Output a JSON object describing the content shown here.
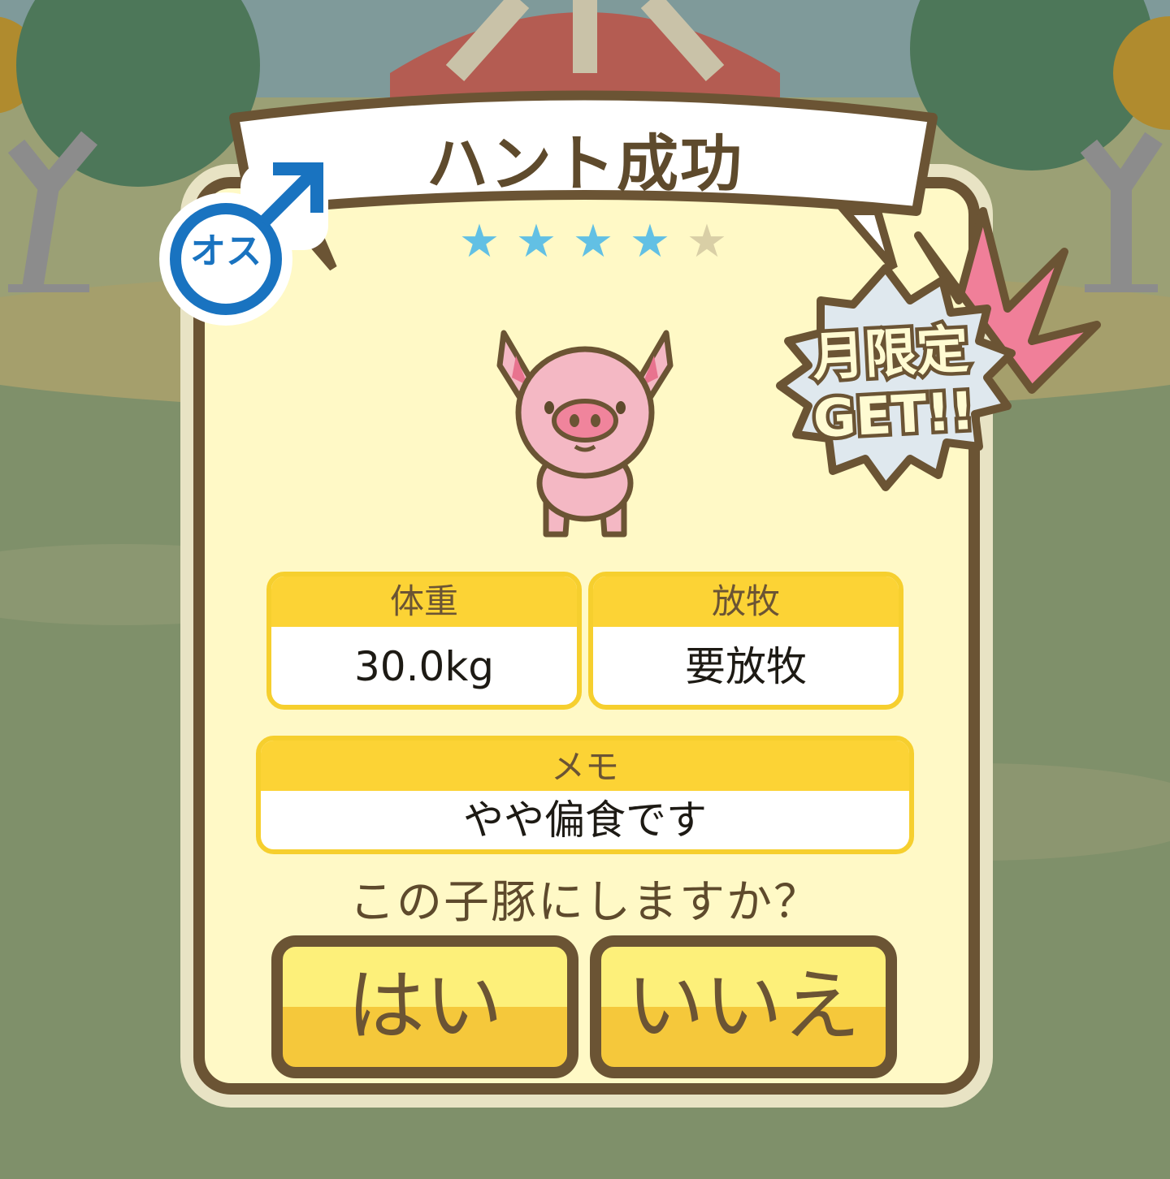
{
  "title": "ハント成功",
  "rarity": {
    "filled": 4,
    "total": 5
  },
  "gender_label": "オス",
  "limited_badge": {
    "line1": "月限定",
    "line2": "GET!!"
  },
  "stats": {
    "weight": {
      "label": "体重",
      "value": "30.0kg"
    },
    "grazing": {
      "label": "放牧",
      "value": "要放牧"
    },
    "memo": {
      "label": "メモ",
      "value": "やや偏食です"
    }
  },
  "question": "この子豚にしますか？",
  "buttons": {
    "yes": "はい",
    "no": "いいえ"
  },
  "colors": {
    "frame": "#6b5434",
    "card": "#fff9c6",
    "header": "#fcd335",
    "star_on": "#62c0e4",
    "male_blue": "#1973c0",
    "pink": "#f07f99"
  }
}
